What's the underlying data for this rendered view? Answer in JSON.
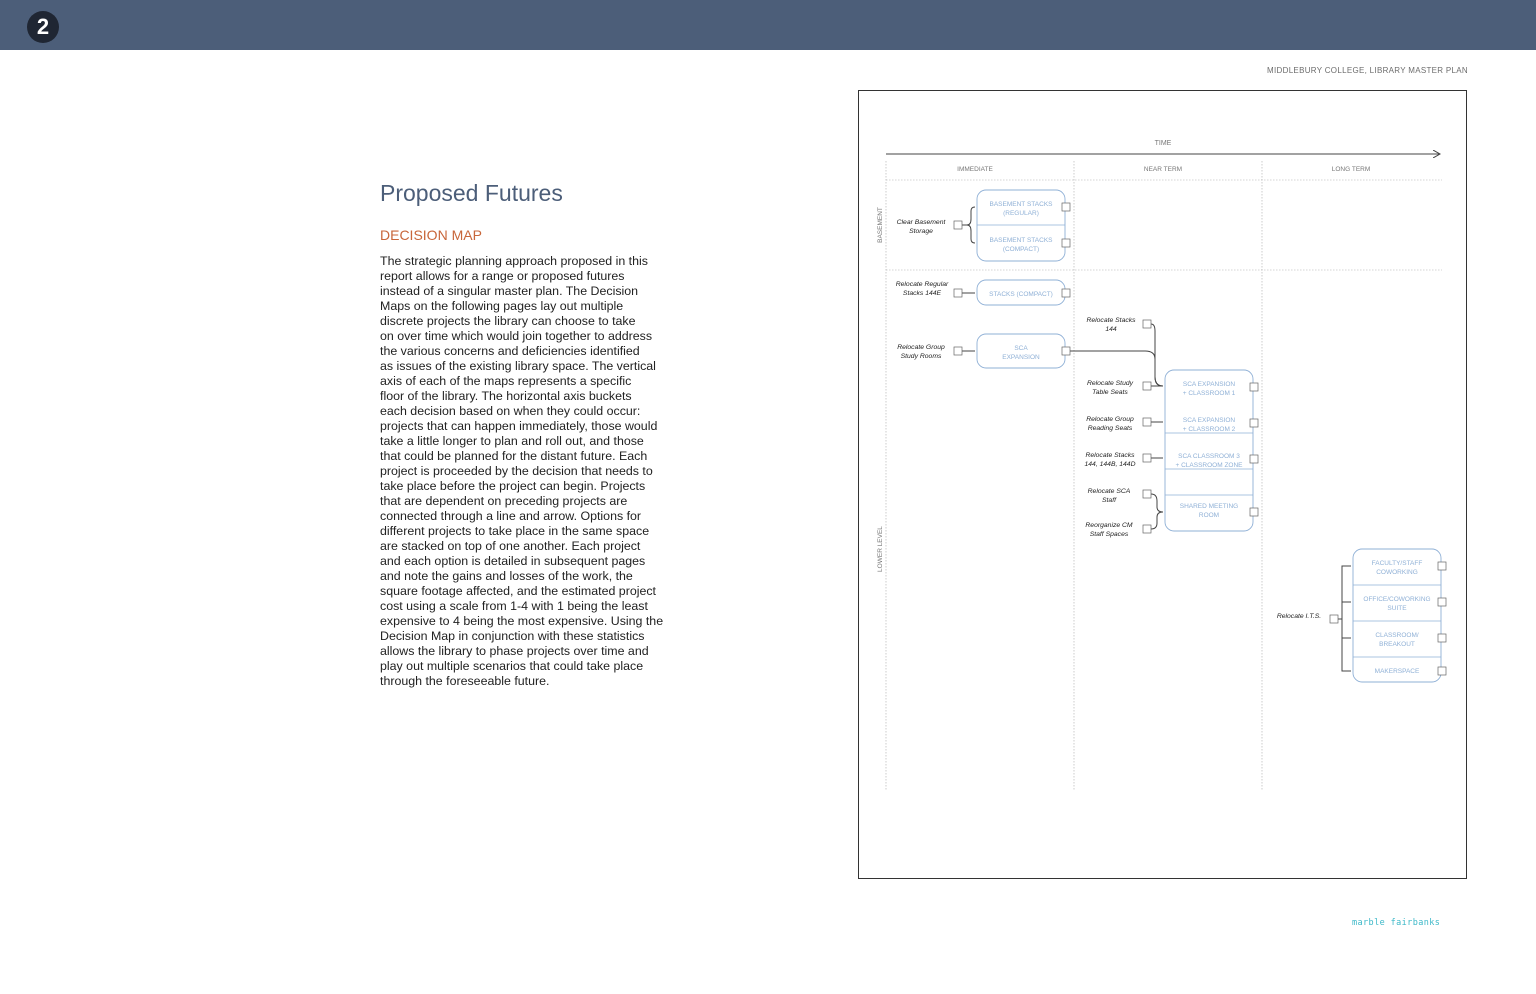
{
  "page": {
    "number": "2",
    "running_header": "MIDDLEBURY COLLEGE, LIBRARY MASTER PLAN",
    "footer_logo": "marble fairbanks"
  },
  "content": {
    "title": "Proposed Futures",
    "subtitle": "DECISION MAP",
    "body_lines": [
      "The strategic planning approach proposed in this",
      "report allows for a range or proposed futures",
      "instead of a singular master plan. The Decision",
      "Maps on the following pages lay out multiple",
      "discrete projects the library can choose to take",
      "on over time which would join together to address",
      "the various concerns and deficiencies identified",
      "as issues of the existing library space. The vertical",
      "axis of each of the maps represents a specific",
      "floor of the library. The horizontal axis buckets",
      "each decision based on when they could occur:",
      "projects that can happen immediately, those would",
      "take a little longer to plan and roll out, and those",
      "that could be planned for the distant future. Each",
      "project is proceeded by the decision that needs to",
      "take place before the project can begin. Projects",
      "that are dependent on preceding projects are",
      "connected through a line and arrow. Options for",
      "different projects to take place in the same space",
      "are stacked on top of one another. Each project",
      "and each option is detailed in subsequent pages",
      "and note the gains and losses of the work, the",
      "square footage affected, and the estimated project",
      "cost using a scale from 1-4 with 1 being the least",
      "expensive to 4 being the most expensive. Using the",
      "Decision Map in conjunction with these statistics",
      "allows the library to phase projects over time and",
      "play out multiple scenarios that could take place",
      "through the foreseeable future."
    ]
  },
  "decision_map": {
    "time_label": "TIME",
    "columns": [
      "IMMEDIATE",
      "NEAR TERM",
      "LONG TERM"
    ],
    "floors": [
      "BASEMENT",
      "LOWER LEVEL"
    ],
    "decisions": [
      [
        "Clear Basement",
        "Storage"
      ],
      [
        "Relocate Regular",
        "Stacks 144E"
      ],
      [
        "Relocate Group",
        "Study Rooms"
      ],
      [
        "Relocate Stacks",
        "144"
      ],
      [
        "Relocate Study",
        "Table Seats"
      ],
      [
        "Relocate Group",
        "Reading Seats"
      ],
      [
        "Relocate Stacks",
        "144, 144B, 144D"
      ],
      [
        "Relocate SCA",
        "Staff"
      ],
      [
        "Reorganize CM",
        "Staff Spaces"
      ],
      [
        "Relocate I.T.S."
      ]
    ],
    "projects": [
      [
        "BASEMENT STACKS",
        "(REGULAR)"
      ],
      [
        "BASEMENT STACKS",
        "(COMPACT)"
      ],
      [
        "STACKS (COMPACT)"
      ],
      [
        "SCA",
        "EXPANSION"
      ],
      [
        "SCA EXPANSION",
        "+ CLASSROOM 1"
      ],
      [
        "SCA EXPANSION",
        "+ CLASSROOM 2"
      ],
      [
        "SCA CLASSROOM 3",
        "+ CLASSROOM ZONE"
      ],
      [
        "SHARED MEETING",
        "ROOM"
      ],
      [
        "FACULTY/STAFF",
        "COWORKING"
      ],
      [
        "OFFICE/COWORKING",
        "SUITE"
      ],
      [
        "CLASSROOM/",
        "BREAKOUT"
      ],
      [
        "MAKERSPACE"
      ]
    ],
    "colors": {
      "project": "#8fb0d6",
      "decision": "#222222",
      "line": "#444444",
      "grid": "#aaaaaa"
    }
  }
}
